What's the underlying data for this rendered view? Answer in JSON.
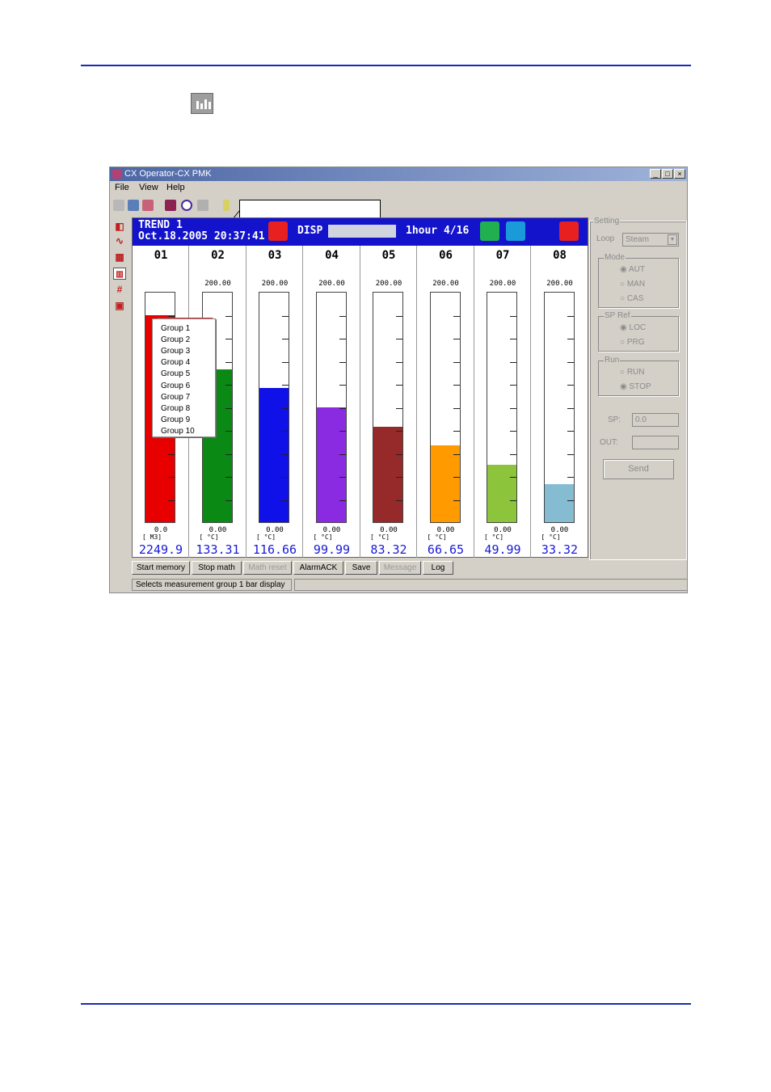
{
  "window": {
    "title": "CX Operator-CX PMK",
    "controls": [
      "_",
      "□",
      "×"
    ]
  },
  "menu": [
    "File",
    "View",
    "Help"
  ],
  "display": {
    "header_line1": "TREND 1",
    "header_line2": "Oct.18.2005 20:37:41",
    "mode": "DISP",
    "time_div": "1hour 4/16"
  },
  "channels": [
    {
      "num": "01",
      "max": "",
      "min": "0.0",
      "unit": "[   M3]",
      "value": "2249.9",
      "level": 0.9,
      "color": "#e80000"
    },
    {
      "num": "02",
      "max": "200.00",
      "min": "0.00",
      "unit": "[   °C]",
      "value": "133.31",
      "level": 0.667,
      "color": "#0a8a14"
    },
    {
      "num": "03",
      "max": "200.00",
      "min": "0.00",
      "unit": "[   °C]",
      "value": "116.66",
      "level": 0.583,
      "color": "#1010e8"
    },
    {
      "num": "04",
      "max": "200.00",
      "min": "0.00",
      "unit": "[   °C]",
      "value": "99.99",
      "level": 0.5,
      "color": "#8a2be2"
    },
    {
      "num": "05",
      "max": "200.00",
      "min": "0.00",
      "unit": "[   °C]",
      "value": "83.32",
      "level": 0.417,
      "color": "#962a2a"
    },
    {
      "num": "06",
      "max": "200.00",
      "min": "0.00",
      "unit": "[   °C]",
      "value": "66.65",
      "level": 0.333,
      "color": "#ff9a00"
    },
    {
      "num": "07",
      "max": "200.00",
      "min": "0.00",
      "unit": "[   °C]",
      "value": "49.99",
      "level": 0.25,
      "color": "#8cc43c"
    },
    {
      "num": "08",
      "max": "200.00",
      "min": "0.00",
      "unit": "[   °C]",
      "value": "33.32",
      "level": 0.167,
      "color": "#86bcd2"
    }
  ],
  "group_menu": [
    "Group 1",
    "Group 2",
    "Group 3",
    "Group 4",
    "Group 5",
    "Group 6",
    "Group 7",
    "Group 8",
    "Group 9",
    "Group 10"
  ],
  "setting": {
    "title": "Setting",
    "loop_label": "Loop",
    "loop_value": "Steam",
    "mode_label": "Mode",
    "mode_options": [
      "AUT",
      "MAN",
      "CAS"
    ],
    "mode_selected": 0,
    "spref_label": "SP Ref",
    "spref_options": [
      "LOC",
      "PRG"
    ],
    "spref_selected": 0,
    "run_label": "Run",
    "run_options": [
      "RUN",
      "STOP"
    ],
    "run_selected": 1,
    "sp_label": "SP:",
    "sp_value": "0.0",
    "out_label": "OUT:",
    "out_value": "",
    "send_label": "Send"
  },
  "bottom_buttons": [
    {
      "label": "Start memory",
      "enabled": true
    },
    {
      "label": "Stop math",
      "enabled": true
    },
    {
      "label": "Math reset",
      "enabled": false
    },
    {
      "label": "AlarmACK",
      "enabled": true
    },
    {
      "label": "Save",
      "enabled": true
    },
    {
      "label": "Message",
      "enabled": false
    },
    {
      "label": "Log",
      "enabled": true
    }
  ],
  "status": "Selects measurement group 1 bar display",
  "colors": {
    "accent_rule": "#1a2bb5",
    "display_header": "#1313cc",
    "highlight_ring": "#d82828"
  }
}
